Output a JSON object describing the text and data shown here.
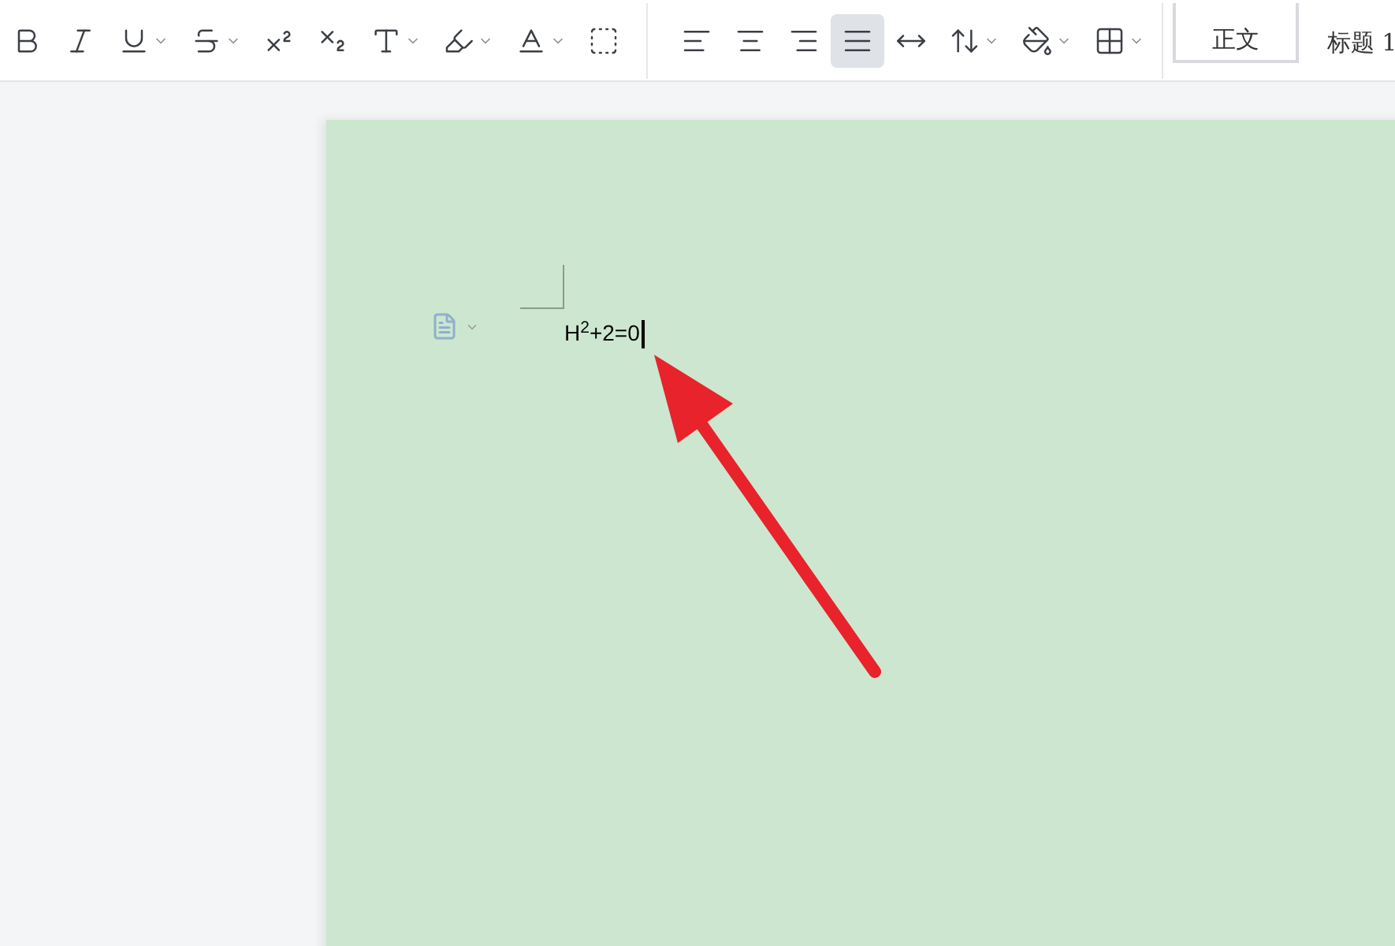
{
  "toolbar": {
    "font_group": [
      {
        "selected": false,
        "has_menu": false
      },
      {
        "selected": false,
        "has_menu": false
      },
      {
        "selected": false,
        "has_menu": true
      },
      {
        "selected": false,
        "has_menu": true
      },
      {
        "selected": false,
        "has_menu": false
      },
      {
        "selected": false,
        "has_menu": false
      },
      {
        "selected": false,
        "has_menu": true
      },
      {
        "selected": false,
        "has_menu": true
      },
      {
        "selected": false,
        "has_menu": true
      },
      {
        "selected": false,
        "has_menu": false
      }
    ],
    "paragraph_group": [
      {
        "selected": false,
        "has_menu": false
      },
      {
        "selected": false,
        "has_menu": false
      },
      {
        "selected": false,
        "has_menu": false
      },
      {
        "selected": true,
        "has_menu": false
      },
      {
        "selected": false,
        "has_menu": false
      },
      {
        "selected": false,
        "has_menu": true
      },
      {
        "selected": false,
        "has_menu": true
      },
      {
        "selected": false,
        "has_menu": true
      }
    ],
    "styles": [
      {
        "label": "正文",
        "selected": true
      },
      {
        "label": "标题 1",
        "selected": false
      }
    ]
  },
  "document": {
    "text": "H$^{2}$+2=0"
  }
}
